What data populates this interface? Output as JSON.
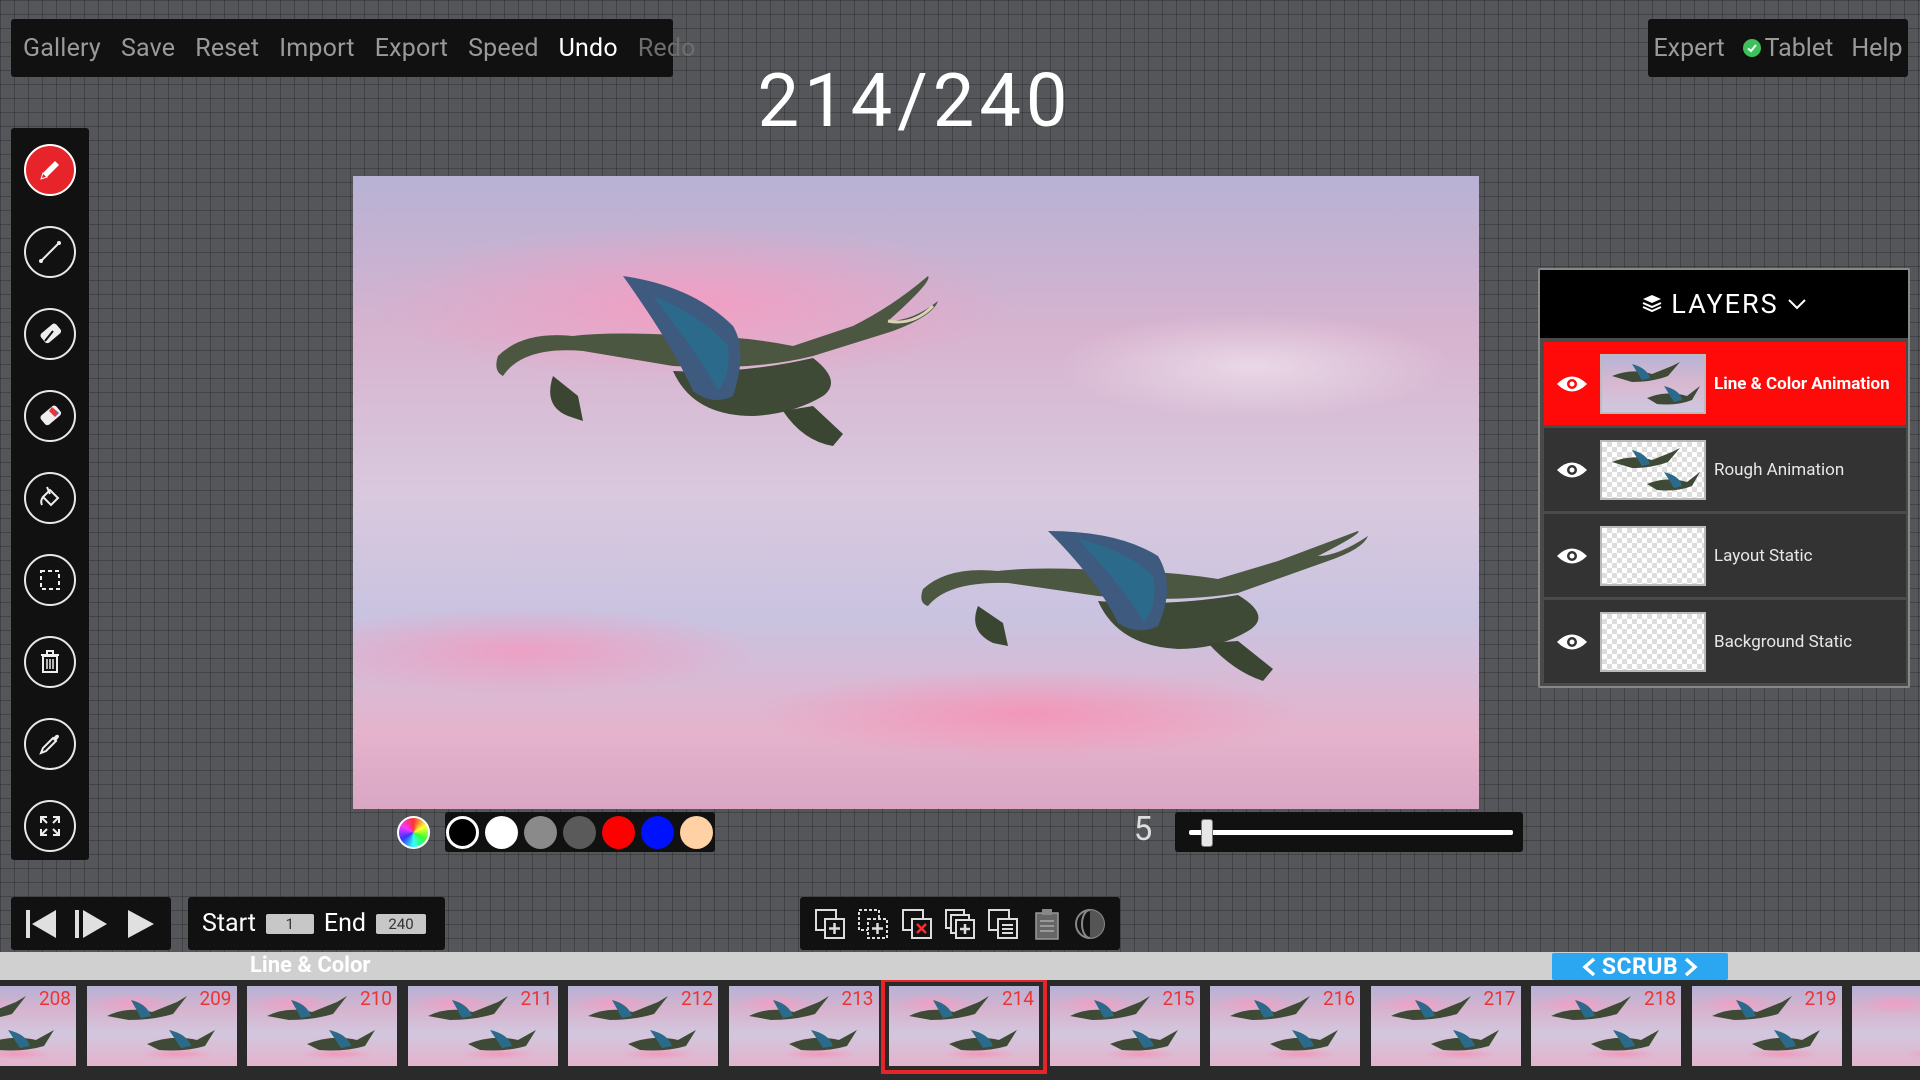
{
  "menu": {
    "items": [
      "Gallery",
      "Save",
      "Reset",
      "Import",
      "Export",
      "Speed",
      "Undo",
      "Redo"
    ]
  },
  "frame_counter": "214/240",
  "top_right": {
    "expert": "Expert",
    "tablet": "Tablet",
    "help": "Help"
  },
  "tools": [
    "pencil-icon",
    "line-icon",
    "eraser-icon",
    "color-eraser-icon",
    "fill-bucket-icon",
    "selection-icon",
    "trash-icon",
    "eyedropper-icon",
    "expand-icon"
  ],
  "palette": {
    "colors": [
      "#000000",
      "#ffffff",
      "#8a8a8a",
      "#5a5a5a",
      "#ff0000",
      "#0011ff",
      "#ffd1a4"
    ],
    "selected": "#000000"
  },
  "brush_size": {
    "value": "5",
    "level": 0.04
  },
  "range": {
    "start_label": "Start",
    "start_value": "1",
    "end_label": "End",
    "end_value": "240"
  },
  "timeline": {
    "layer_label": "Line & Color",
    "scrub_label": "SCRUB",
    "frames": [
      "208",
      "209",
      "210",
      "211",
      "212",
      "213",
      "214",
      "215",
      "216",
      "217",
      "218",
      "219"
    ],
    "current": "214"
  },
  "layers": {
    "title": "LAYERS",
    "items": [
      {
        "name": "Line & Color Animation",
        "active": true
      },
      {
        "name": "Rough Animation",
        "active": false
      },
      {
        "name": "Layout Static",
        "active": false
      },
      {
        "name": "Background Static",
        "active": false
      }
    ]
  },
  "colors": {
    "accent": "#e8242b",
    "scrub": "#2aa7f0",
    "active_layer": "#ff0909"
  }
}
